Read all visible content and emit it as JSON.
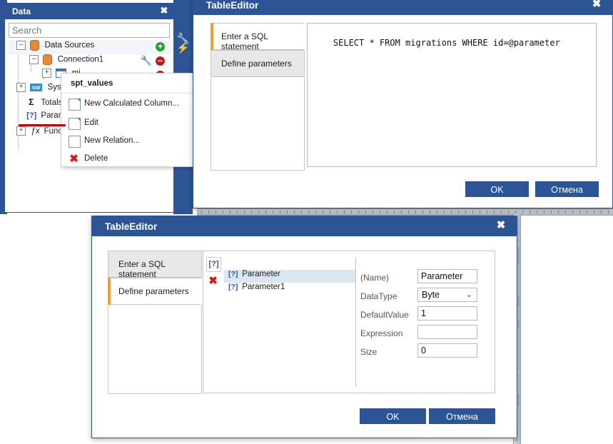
{
  "app": {
    "side_tools": [
      {
        "name": "wrench-icon",
        "glyph": "🔧"
      },
      {
        "name": "lightning-icon",
        "glyph": "⚡"
      }
    ]
  },
  "data_panel": {
    "title": "Data",
    "close_label": "✖",
    "search": {
      "value": "",
      "placeholder": "Search"
    },
    "tree": [
      {
        "label": "Data Sources",
        "icon": "database-icon",
        "expander": "-",
        "indent": 0,
        "action": "add"
      },
      {
        "label": "Connection1",
        "icon": "database-icon",
        "expander": "-",
        "indent": 1,
        "action": "remove",
        "wrench": true
      },
      {
        "label": "mi",
        "icon": "table-icon",
        "expander": "+",
        "indent": 2,
        "action": "remove"
      },
      {
        "label": "System V",
        "icon": "var-icon",
        "expander": "+",
        "indent": 0
      },
      {
        "label": "Totals",
        "icon": "sigma-icon",
        "expander": "",
        "indent": 1
      },
      {
        "label": "Paramete",
        "icon": "parameter-icon",
        "expander": "",
        "indent": 1
      },
      {
        "label": "Functions",
        "icon": "fx-icon",
        "expander": "+",
        "indent": 0
      }
    ]
  },
  "context_menu": {
    "header": "spt_values",
    "items": [
      {
        "label": "New Calculated Column...",
        "icon": "calculated-column-icon"
      },
      {
        "label": "Edit",
        "icon": "edit-icon"
      },
      {
        "label": "New Relation...",
        "icon": "new-relation-icon"
      },
      {
        "label": "Delete",
        "icon": "delete-icon"
      }
    ]
  },
  "dialog_top": {
    "title": "TableEditor",
    "close_label": "✖",
    "tabs": [
      {
        "label": "Enter a SQL statement",
        "active": true
      },
      {
        "label": "Define parameters",
        "active": false
      }
    ],
    "sql_text": "SELECT * FROM migrations WHERE id=@parameter",
    "buttons": {
      "ok": "OK",
      "cancel": "Отмена"
    }
  },
  "dialog_bottom": {
    "title": "TableEditor",
    "close_label": "✖",
    "tabs": [
      {
        "label": "Enter a SQL statement",
        "active": false
      },
      {
        "label": "Define parameters",
        "active": true
      }
    ],
    "toolbar": {
      "add_icon": "add-parameter-icon",
      "add_glyph": "[?]",
      "delete_glyph": "✖"
    },
    "parameters": [
      {
        "label": "Parameter",
        "selected": true
      },
      {
        "label": "Parameter1",
        "selected": false
      }
    ],
    "properties": [
      {
        "label": "(Name)",
        "value": "Parameter",
        "type": "text"
      },
      {
        "label": "DataType",
        "value": "Byte",
        "type": "select"
      },
      {
        "label": "DefaultValue",
        "value": "1",
        "type": "text"
      },
      {
        "label": "Expression",
        "value": "",
        "type": "text"
      },
      {
        "label": "Size",
        "value": "0",
        "type": "text"
      }
    ],
    "buttons": {
      "ok": "OK",
      "cancel": "Отмена"
    }
  },
  "colors": {
    "title_bar": "#2d5596",
    "accent_orange": "#f0a030",
    "selection": "#dce6f2",
    "underline_red": "#c00000"
  }
}
